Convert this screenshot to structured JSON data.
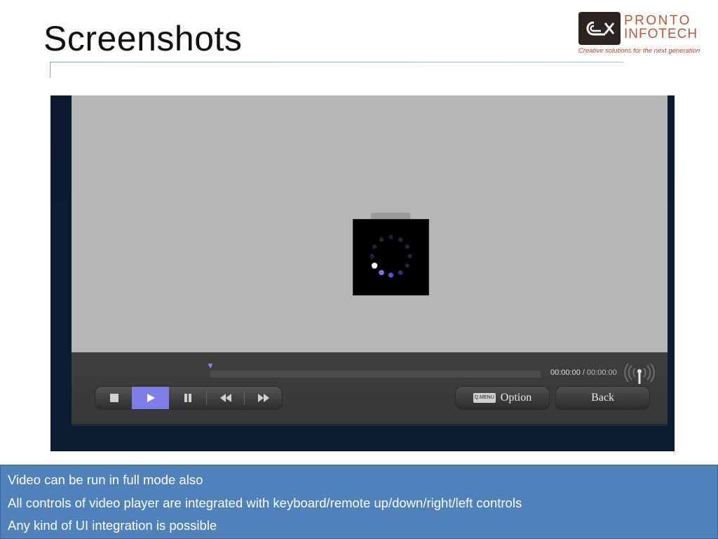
{
  "slide": {
    "title": "Screenshots"
  },
  "logo": {
    "name_line1": "PRONTO",
    "name_line2": "INFOTECH",
    "tagline": "Creative solutions for the next generation"
  },
  "player": {
    "loading": true,
    "progress": 0,
    "time_current": "00:00:00",
    "time_separator": "/",
    "time_total": "00:00:00",
    "controls": [
      {
        "name": "stop-button",
        "icon": "stop-icon"
      },
      {
        "name": "play-button",
        "icon": "play-icon",
        "active": true
      },
      {
        "name": "pause-button",
        "icon": "pause-icon"
      },
      {
        "name": "rewind-button",
        "icon": "rewind-icon"
      },
      {
        "name": "fast-forward-button",
        "icon": "fast-forward-icon"
      }
    ],
    "menu_key_label": "Q.MENU",
    "option_label": "Option",
    "back_label": "Back",
    "accent_color": "#8c7fff"
  },
  "caption": {
    "lines": [
      "Video can be run in full mode also",
      "All controls of video player are integrated with keyboard/remote up/down/right/left controls",
      "Any kind of UI integration is possible"
    ],
    "background_color": "#4f81bd"
  }
}
